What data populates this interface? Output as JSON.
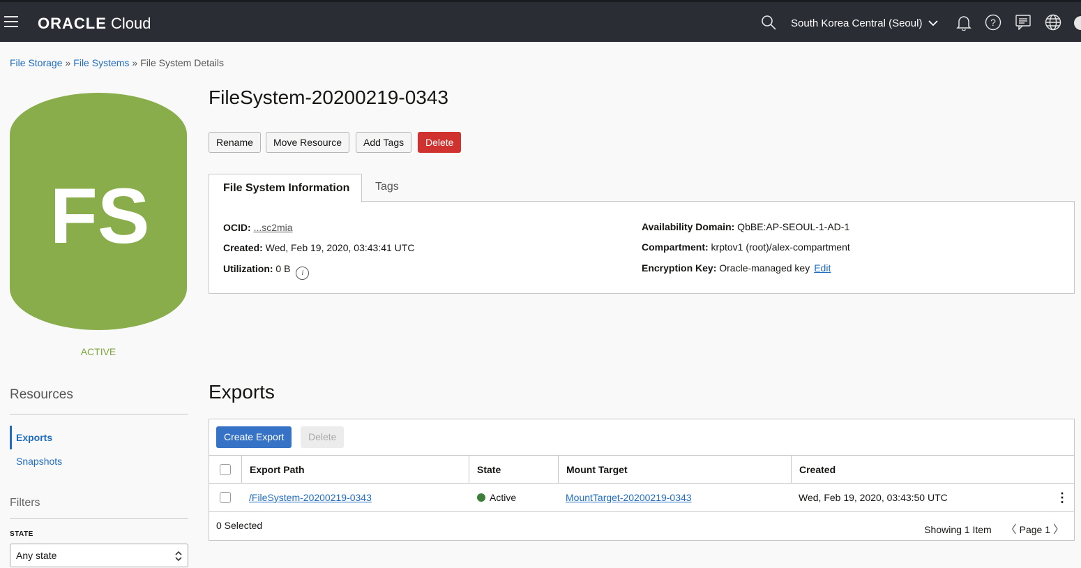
{
  "header": {
    "brand_bold": "ORACLE",
    "brand_light": " Cloud",
    "region": "South Korea Central (Seoul)",
    "icons": [
      "menu-icon",
      "search-icon",
      "bell-icon",
      "help-icon",
      "chat-icon",
      "globe-icon"
    ]
  },
  "breadcrumb": {
    "item1": "File Storage",
    "sep": "»",
    "item2": "File Systems",
    "item3": "File System Details"
  },
  "resource_icon": {
    "initials": "FS",
    "color": "#88ad4a",
    "status": "ACTIVE"
  },
  "sidebar": {
    "resources_title": "Resources",
    "items": [
      {
        "label": "Exports",
        "active": true
      },
      {
        "label": "Snapshots",
        "active": false
      }
    ],
    "filters_title": "Filters",
    "state_label": "STATE",
    "state_value": "Any state"
  },
  "details": {
    "title": "FileSystem-20200219-0343",
    "actions": {
      "rename": "Rename",
      "move": "Move Resource",
      "add_tags": "Add Tags",
      "delete": "Delete"
    },
    "tabs": {
      "info": "File System Information",
      "tags": "Tags"
    },
    "info": {
      "ocid_label": "OCID:",
      "ocid_value": "...sc2mia",
      "created_label": "Created:",
      "created_value": " Wed, Feb 19, 2020, 03:43:41 UTC",
      "util_label": "Utilization:",
      "util_value": " 0 B",
      "util_info": "i",
      "ad_label": "Availability Domain:",
      "ad_value": " QbBE:AP-SEOUL-1-AD-1",
      "comp_label": "Compartment:",
      "comp_value": " krptov1 (root)/alex-compartment",
      "key_label": "Encryption Key:",
      "key_value": " Oracle-managed key",
      "key_edit": "Edit"
    }
  },
  "exports": {
    "title": "Exports",
    "create_label": "Create Export",
    "delete_label": "Delete",
    "columns": [
      "Export Path",
      "State",
      "Mount Target",
      "Created"
    ],
    "rows": [
      {
        "path": "/FileSystem-20200219-0343",
        "state": "Active",
        "mount_target": "MountTarget-20200219-0343",
        "created": "Wed, Feb 19, 2020, 03:43:50 UTC"
      }
    ],
    "selected_text": "0 Selected",
    "showing_text": "Showing 1 Item",
    "page_text": "Page 1"
  }
}
